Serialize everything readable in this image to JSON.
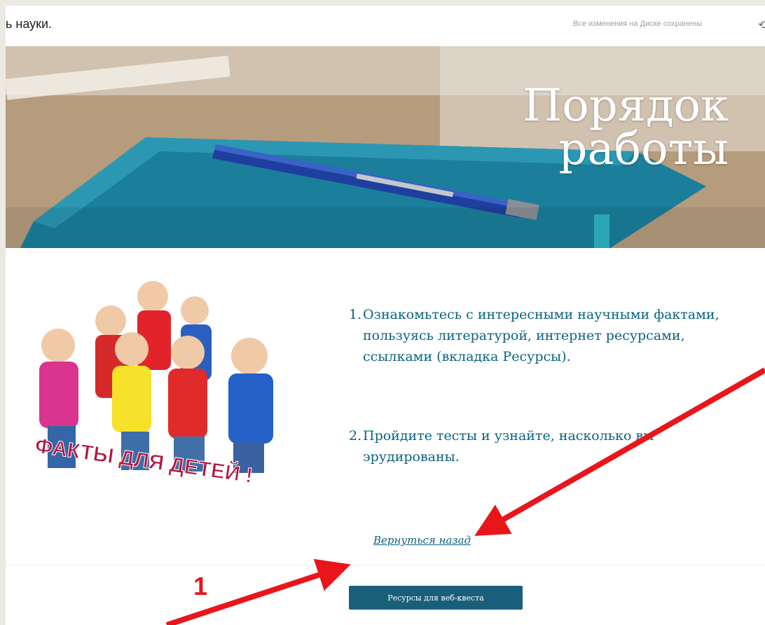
{
  "topbar": {
    "doc_title": "ь науки.",
    "save_status": "Все изменения на Диске сохранены",
    "undo_icon_glyph": "⟲"
  },
  "banner": {
    "title_line1": "Порядок",
    "title_line2": "работы"
  },
  "image": {
    "caption": "ФАКТЫ ДЛЯ ДЕТЕЙ !"
  },
  "steps": [
    {
      "num": "1.",
      "text": "Ознакомьтесь с интересными научными фактами, пользуясь литературой, интернет ресурсами, ссылками (вкладка Ресурсы)."
    },
    {
      "num": "2.",
      "text": "Пройдите тесты и узнайте, насколько вы эрудированы."
    }
  ],
  "back_link": "Вернуться назад",
  "footer": {
    "button_label": "Ресурсы для веб-квеста"
  },
  "annotation": {
    "number": "1",
    "color": "#e8161b"
  },
  "colors": {
    "accent_text": "#0b6380",
    "button_bg": "#1a5f7a"
  }
}
